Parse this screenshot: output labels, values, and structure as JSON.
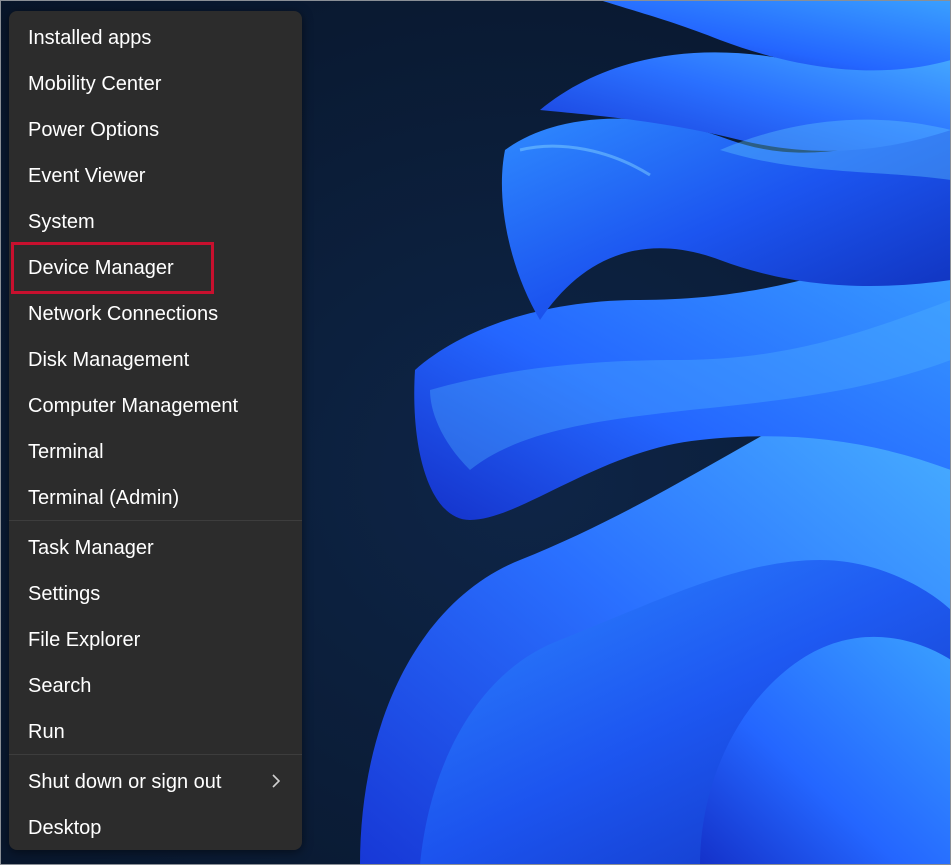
{
  "menu": {
    "group1": [
      {
        "id": "installed-apps",
        "label": "Installed apps"
      },
      {
        "id": "mobility-center",
        "label": "Mobility Center"
      },
      {
        "id": "power-options",
        "label": "Power Options"
      },
      {
        "id": "event-viewer",
        "label": "Event Viewer"
      },
      {
        "id": "system",
        "label": "System"
      },
      {
        "id": "device-manager",
        "label": "Device Manager"
      },
      {
        "id": "network-connections",
        "label": "Network Connections"
      },
      {
        "id": "disk-management",
        "label": "Disk Management"
      },
      {
        "id": "computer-management",
        "label": "Computer Management"
      },
      {
        "id": "terminal",
        "label": "Terminal"
      },
      {
        "id": "terminal-admin",
        "label": "Terminal (Admin)"
      }
    ],
    "group2": [
      {
        "id": "task-manager",
        "label": "Task Manager"
      },
      {
        "id": "settings",
        "label": "Settings"
      },
      {
        "id": "file-explorer",
        "label": "File Explorer"
      },
      {
        "id": "search",
        "label": "Search"
      },
      {
        "id": "run",
        "label": "Run"
      }
    ],
    "group3": [
      {
        "id": "shut-down",
        "label": "Shut down or sign out",
        "icon": "chevron-right-icon"
      },
      {
        "id": "desktop",
        "label": "Desktop"
      }
    ]
  },
  "colors": {
    "menu_bg": "#2c2c2c",
    "text": "#ffffff",
    "highlight_border": "#c8102e",
    "wallpaper_dark": "#0b1a33",
    "wallpaper_blue": "#1f5cff"
  }
}
